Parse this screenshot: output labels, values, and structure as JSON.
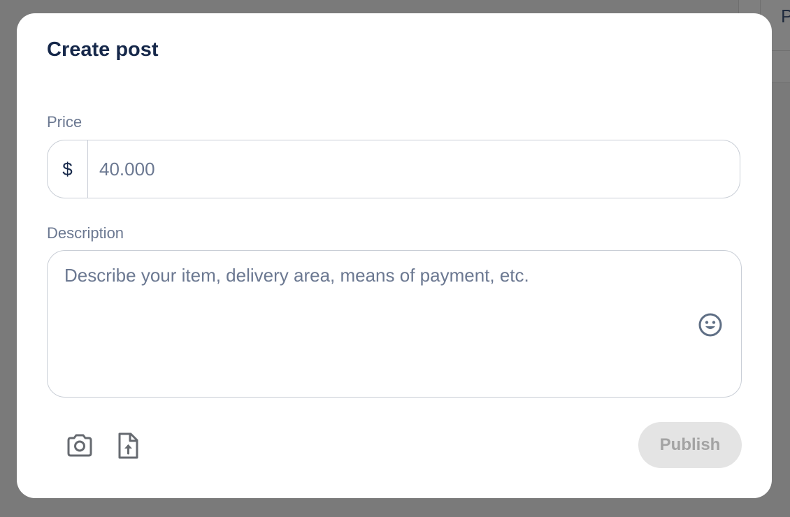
{
  "background": {
    "partial_text": "P"
  },
  "modal": {
    "title": "Create post",
    "price": {
      "label": "Price",
      "currency_symbol": "$",
      "placeholder": "40.000",
      "value": ""
    },
    "description": {
      "label": "Description",
      "placeholder": "Describe your item, delivery area, means of payment, etc.",
      "value": ""
    },
    "toolbar": {
      "icons": [
        "camera-icon",
        "file-upload-icon",
        "emoji-icon"
      ]
    },
    "publish": {
      "label": "Publish",
      "enabled": false
    }
  },
  "colors": {
    "overlay": "#7a7a7a",
    "title": "#16284a",
    "label": "#6b7891",
    "border": "#c9ced6",
    "publish_bg_disabled": "#e4e4e4",
    "publish_text_disabled": "#a3a3a3"
  }
}
